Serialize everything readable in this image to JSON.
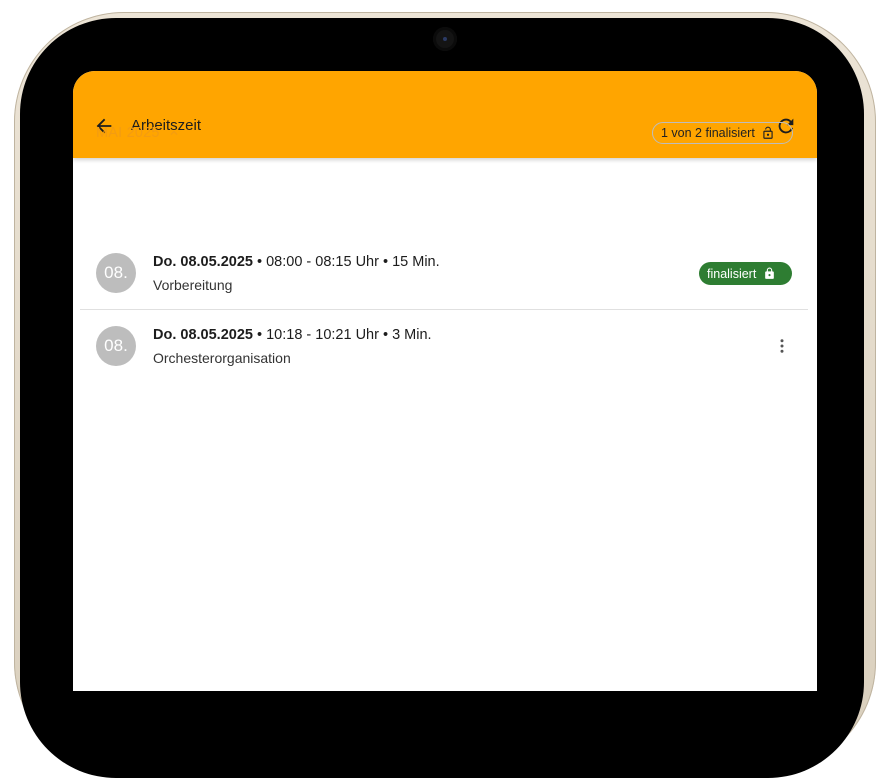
{
  "colors": {
    "accent": "#FFA500",
    "month_text": "#F39C12",
    "success": "#2E7D32",
    "avatar": "#BDBDBD"
  },
  "appbar": {
    "title": "Arbeitszeit",
    "back_icon": "arrow-left-icon",
    "refresh_icon": "refresh-icon"
  },
  "month_header": {
    "label": "MAI 2025",
    "chevron_icon": "chevron-up-icon",
    "status_text": "1 von 2 finalisiert",
    "status_icon": "lock-open-icon"
  },
  "entries": [
    {
      "avatar": "08.",
      "date": "Do. 08.05.2025",
      "details": " • 08:00 - 08:15 Uhr • 15 Min.",
      "activity": "Vorbereitung",
      "badge": "finalisiert",
      "badge_icon": "lock-icon"
    },
    {
      "avatar": "08.",
      "date": "Do. 08.05.2025",
      "details": " • 10:18 - 10:21 Uhr • 3 Min.",
      "activity": "Orchesterorganisation",
      "menu_icon": "more-vert-icon"
    }
  ]
}
